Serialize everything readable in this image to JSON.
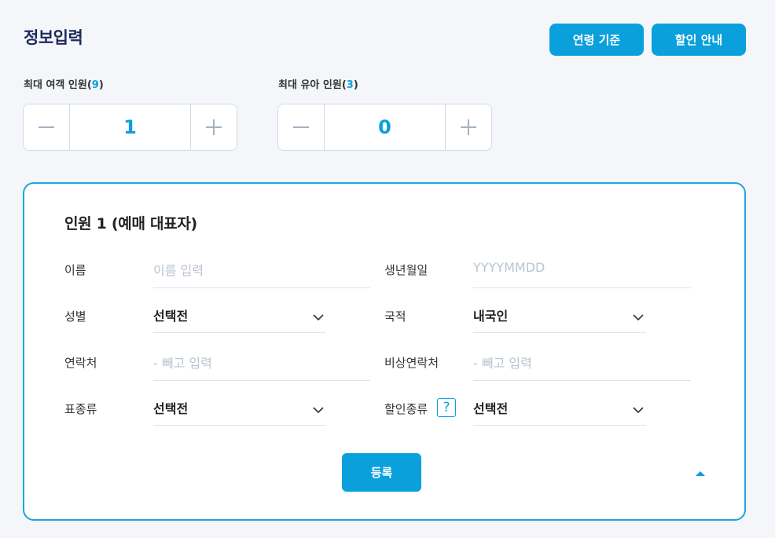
{
  "header": {
    "title": "정보입력",
    "age_button": "연령 기준",
    "discount_button": "할인 안내"
  },
  "counters": {
    "adult": {
      "label": "최대 여객 인원",
      "max": "9",
      "value": "1"
    },
    "infant": {
      "label": "최대 유아 인원",
      "max": "3",
      "value": "0"
    }
  },
  "passenger": {
    "title": "인원 1 (예매 대표자)",
    "fields": {
      "name": {
        "label": "이름",
        "placeholder": "이름 입력"
      },
      "birth": {
        "label": "생년월일",
        "placeholder": "YYYYMMDD"
      },
      "gender": {
        "label": "성별",
        "value": "선택전"
      },
      "nationality": {
        "label": "국적",
        "value": "내국인"
      },
      "phone": {
        "label": "연락처",
        "placeholder": "- 빼고 입력"
      },
      "emergency": {
        "label": "비상연락처",
        "placeholder": "- 빼고 입력"
      },
      "ticket_type": {
        "label": "표종류",
        "value": "선택전"
      },
      "discount_type": {
        "label": "할인종류",
        "value": "선택전",
        "help": "?"
      }
    },
    "register_button": "등록"
  },
  "colors": {
    "accent": "#0aa0dc",
    "title": "#1e2a5a",
    "placeholder": "#b9c4d4"
  }
}
